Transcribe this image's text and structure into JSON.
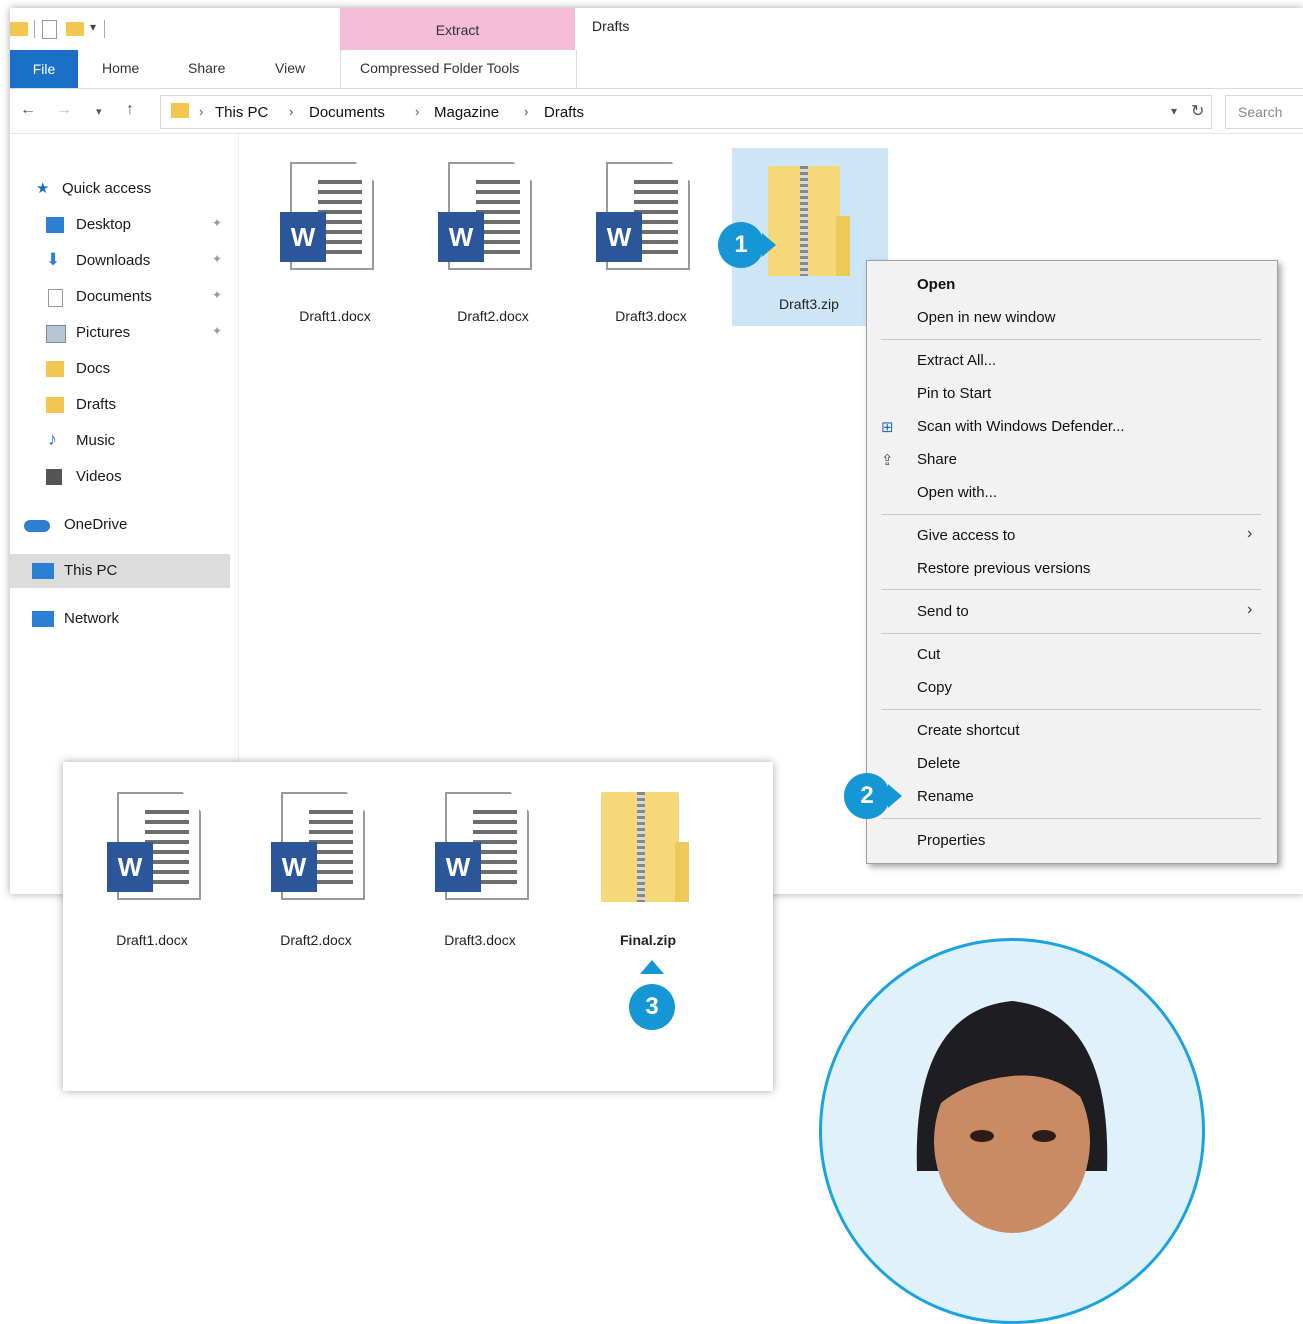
{
  "window": {
    "title": "Drafts",
    "context_tab": "Extract",
    "context_group": "Compressed Folder Tools",
    "tabs": [
      "File",
      "Home",
      "Share",
      "View"
    ]
  },
  "address": {
    "crumbs": [
      "This PC",
      "Documents",
      "Magazine",
      "Drafts"
    ],
    "search_placeholder": "Search"
  },
  "nav": {
    "quick_access": "Quick access",
    "items": [
      "Desktop",
      "Downloads",
      "Documents",
      "Pictures",
      "Docs",
      "Drafts",
      "Music",
      "Videos"
    ],
    "onedrive": "OneDrive",
    "thispc": "This PC",
    "network": "Network"
  },
  "files": [
    "Draft1.docx",
    "Draft2.docx",
    "Draft3.docx",
    "Draft3.zip"
  ],
  "context_menu": {
    "open": "Open",
    "open_new": "Open in new window",
    "extract_all": "Extract All...",
    "pin_start": "Pin to Start",
    "scan": "Scan with Windows Defender...",
    "share": "Share",
    "open_with": "Open with...",
    "give_access": "Give access to",
    "restore": "Restore previous versions",
    "send_to": "Send to",
    "cut": "Cut",
    "copy": "Copy",
    "create_shortcut": "Create shortcut",
    "delete": "Delete",
    "rename": "Rename",
    "properties": "Properties"
  },
  "inset_files": [
    "Draft1.docx",
    "Draft2.docx",
    "Draft3.docx",
    "Final.zip"
  ],
  "steps": [
    "1",
    "2",
    "3"
  ],
  "icons": {
    "word": "W",
    "back": "back-arrow-icon",
    "forward": "forward-arrow-icon",
    "up": "up-arrow-icon",
    "refresh": "refresh-icon"
  },
  "colors": {
    "accent": "#1a6fc6",
    "extract_tab": "#f5bcd7",
    "selection": "#cde6f7",
    "badge": "#1497d4",
    "word_blue": "#2b579a",
    "folder": "#f3c64f"
  }
}
